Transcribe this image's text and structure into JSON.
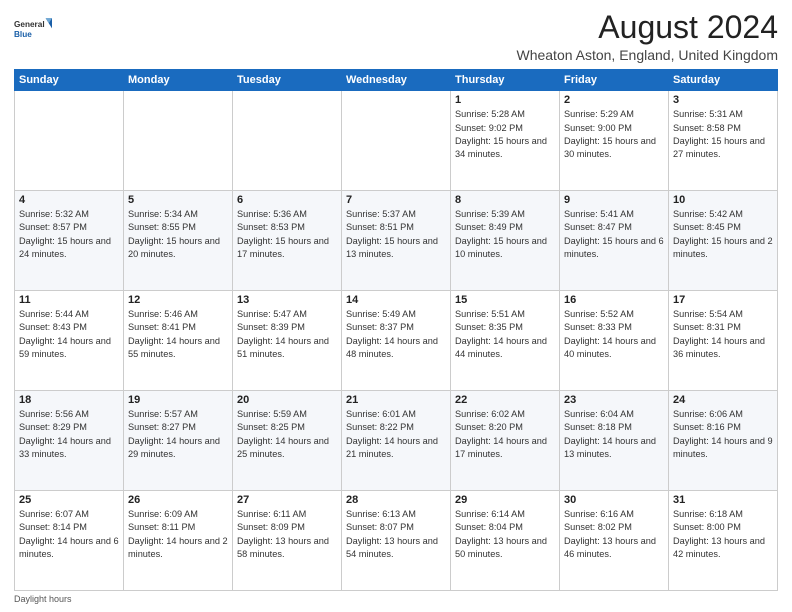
{
  "logo": {
    "general": "General",
    "blue": "Blue"
  },
  "title": "August 2024",
  "subtitle": "Wheaton Aston, England, United Kingdom",
  "days_of_week": [
    "Sunday",
    "Monday",
    "Tuesday",
    "Wednesday",
    "Thursday",
    "Friday",
    "Saturday"
  ],
  "footer": "Daylight hours",
  "weeks": [
    [
      {
        "day": "",
        "info": ""
      },
      {
        "day": "",
        "info": ""
      },
      {
        "day": "",
        "info": ""
      },
      {
        "day": "",
        "info": ""
      },
      {
        "day": "1",
        "sunrise": "5:28 AM",
        "sunset": "9:02 PM",
        "daylight": "15 hours and 34 minutes."
      },
      {
        "day": "2",
        "sunrise": "5:29 AM",
        "sunset": "9:00 PM",
        "daylight": "15 hours and 30 minutes."
      },
      {
        "day": "3",
        "sunrise": "5:31 AM",
        "sunset": "8:58 PM",
        "daylight": "15 hours and 27 minutes."
      }
    ],
    [
      {
        "day": "4",
        "sunrise": "5:32 AM",
        "sunset": "8:57 PM",
        "daylight": "15 hours and 24 minutes."
      },
      {
        "day": "5",
        "sunrise": "5:34 AM",
        "sunset": "8:55 PM",
        "daylight": "15 hours and 20 minutes."
      },
      {
        "day": "6",
        "sunrise": "5:36 AM",
        "sunset": "8:53 PM",
        "daylight": "15 hours and 17 minutes."
      },
      {
        "day": "7",
        "sunrise": "5:37 AM",
        "sunset": "8:51 PM",
        "daylight": "15 hours and 13 minutes."
      },
      {
        "day": "8",
        "sunrise": "5:39 AM",
        "sunset": "8:49 PM",
        "daylight": "15 hours and 10 minutes."
      },
      {
        "day": "9",
        "sunrise": "5:41 AM",
        "sunset": "8:47 PM",
        "daylight": "15 hours and 6 minutes."
      },
      {
        "day": "10",
        "sunrise": "5:42 AM",
        "sunset": "8:45 PM",
        "daylight": "15 hours and 2 minutes."
      }
    ],
    [
      {
        "day": "11",
        "sunrise": "5:44 AM",
        "sunset": "8:43 PM",
        "daylight": "14 hours and 59 minutes."
      },
      {
        "day": "12",
        "sunrise": "5:46 AM",
        "sunset": "8:41 PM",
        "daylight": "14 hours and 55 minutes."
      },
      {
        "day": "13",
        "sunrise": "5:47 AM",
        "sunset": "8:39 PM",
        "daylight": "14 hours and 51 minutes."
      },
      {
        "day": "14",
        "sunrise": "5:49 AM",
        "sunset": "8:37 PM",
        "daylight": "14 hours and 48 minutes."
      },
      {
        "day": "15",
        "sunrise": "5:51 AM",
        "sunset": "8:35 PM",
        "daylight": "14 hours and 44 minutes."
      },
      {
        "day": "16",
        "sunrise": "5:52 AM",
        "sunset": "8:33 PM",
        "daylight": "14 hours and 40 minutes."
      },
      {
        "day": "17",
        "sunrise": "5:54 AM",
        "sunset": "8:31 PM",
        "daylight": "14 hours and 36 minutes."
      }
    ],
    [
      {
        "day": "18",
        "sunrise": "5:56 AM",
        "sunset": "8:29 PM",
        "daylight": "14 hours and 33 minutes."
      },
      {
        "day": "19",
        "sunrise": "5:57 AM",
        "sunset": "8:27 PM",
        "daylight": "14 hours and 29 minutes."
      },
      {
        "day": "20",
        "sunrise": "5:59 AM",
        "sunset": "8:25 PM",
        "daylight": "14 hours and 25 minutes."
      },
      {
        "day": "21",
        "sunrise": "6:01 AM",
        "sunset": "8:22 PM",
        "daylight": "14 hours and 21 minutes."
      },
      {
        "day": "22",
        "sunrise": "6:02 AM",
        "sunset": "8:20 PM",
        "daylight": "14 hours and 17 minutes."
      },
      {
        "day": "23",
        "sunrise": "6:04 AM",
        "sunset": "8:18 PM",
        "daylight": "14 hours and 13 minutes."
      },
      {
        "day": "24",
        "sunrise": "6:06 AM",
        "sunset": "8:16 PM",
        "daylight": "14 hours and 9 minutes."
      }
    ],
    [
      {
        "day": "25",
        "sunrise": "6:07 AM",
        "sunset": "8:14 PM",
        "daylight": "14 hours and 6 minutes."
      },
      {
        "day": "26",
        "sunrise": "6:09 AM",
        "sunset": "8:11 PM",
        "daylight": "14 hours and 2 minutes."
      },
      {
        "day": "27",
        "sunrise": "6:11 AM",
        "sunset": "8:09 PM",
        "daylight": "13 hours and 58 minutes."
      },
      {
        "day": "28",
        "sunrise": "6:13 AM",
        "sunset": "8:07 PM",
        "daylight": "13 hours and 54 minutes."
      },
      {
        "day": "29",
        "sunrise": "6:14 AM",
        "sunset": "8:04 PM",
        "daylight": "13 hours and 50 minutes."
      },
      {
        "day": "30",
        "sunrise": "6:16 AM",
        "sunset": "8:02 PM",
        "daylight": "13 hours and 46 minutes."
      },
      {
        "day": "31",
        "sunrise": "6:18 AM",
        "sunset": "8:00 PM",
        "daylight": "13 hours and 42 minutes."
      }
    ]
  ]
}
